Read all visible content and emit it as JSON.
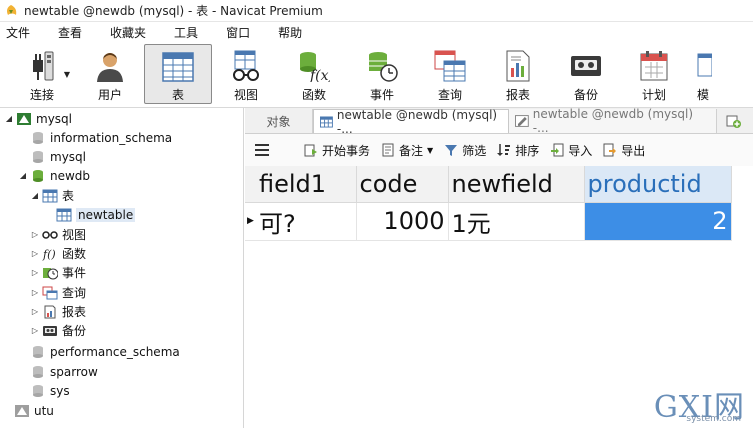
{
  "window": {
    "title": "newtable @newdb (mysql) - 表 - Navicat Premium"
  },
  "menu": [
    "文件",
    "查看",
    "收藏夹",
    "工具",
    "窗口",
    "帮助"
  ],
  "toolbar": [
    {
      "label": "连接",
      "icon": "plug-icon"
    },
    {
      "label": "用户",
      "icon": "user-icon"
    },
    {
      "label": "表",
      "icon": "table-icon",
      "active": true
    },
    {
      "label": "视图",
      "icon": "view-icon"
    },
    {
      "label": "函数",
      "icon": "function-icon"
    },
    {
      "label": "事件",
      "icon": "event-icon"
    },
    {
      "label": "查询",
      "icon": "query-icon"
    },
    {
      "label": "报表",
      "icon": "report-icon"
    },
    {
      "label": "备份",
      "icon": "backup-icon"
    },
    {
      "label": "计划",
      "icon": "schedule-icon"
    },
    {
      "label": "模",
      "icon": "model-icon"
    }
  ],
  "tree": {
    "connection": "mysql",
    "databases": [
      "information_schema",
      "mysql",
      "newdb",
      "performance_schema",
      "sparrow",
      "sys"
    ],
    "newdb_children": {
      "tables_label": "表",
      "table_item": "newtable",
      "others": [
        "视图",
        "函数",
        "事件",
        "查询",
        "报表",
        "备份"
      ]
    },
    "connection2": "utu"
  },
  "tabs": {
    "objects": "对象",
    "active": "newtable @newdb (mysql) -...",
    "inactive": "newtable @newdb (mysql) -..."
  },
  "subtoolbar": {
    "begin_transaction": "开始事务",
    "memo": "备注",
    "filter": "筛选",
    "sort": "排序",
    "import": "导入",
    "export": "导出"
  },
  "grid": {
    "columns": [
      "field1",
      "code",
      "newfield",
      "productid"
    ],
    "rows": [
      [
        "可?",
        "1000",
        "1元",
        "2"
      ]
    ]
  },
  "watermark": {
    "big": "GXI网",
    "small": "system.com"
  }
}
